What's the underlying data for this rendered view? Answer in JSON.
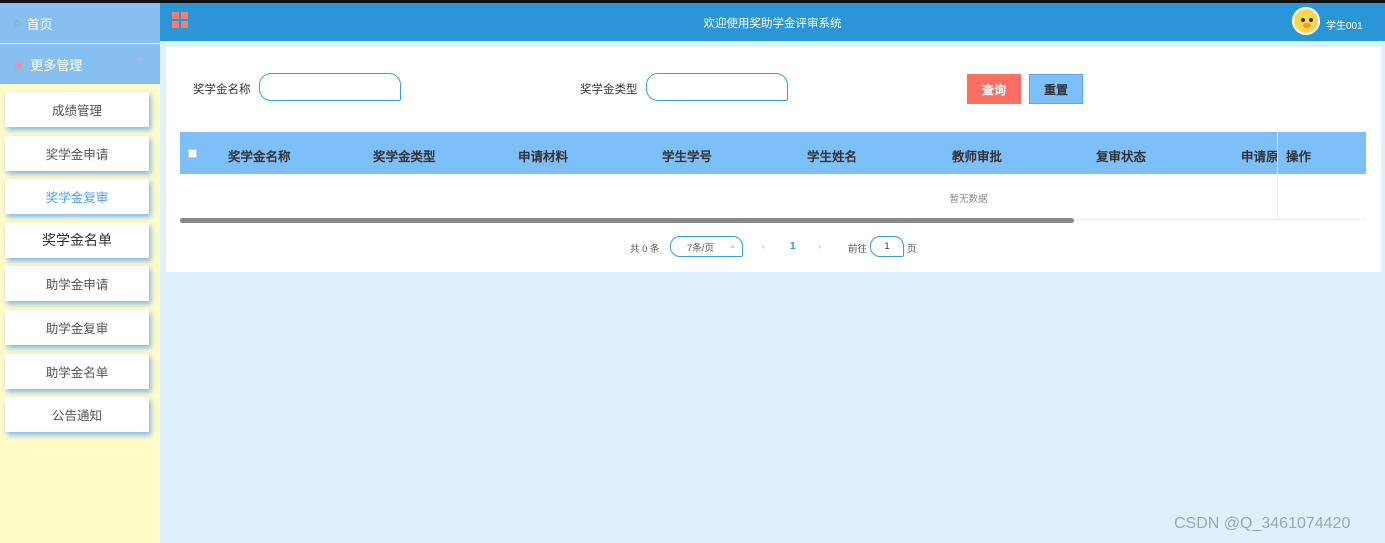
{
  "sidebar": {
    "home": "首页",
    "more": "更多管理",
    "items": [
      {
        "label": "成绩管理"
      },
      {
        "label": "奖学金申请"
      },
      {
        "label": "奖学金复审"
      },
      {
        "label": "奖学金名单"
      },
      {
        "label": "助学金申请"
      },
      {
        "label": "助学金复审"
      },
      {
        "label": "助学金名单"
      },
      {
        "label": "公告通知"
      }
    ]
  },
  "header": {
    "title": "欢迎使用奖助学金评审系统",
    "username": "学生001"
  },
  "search": {
    "name_label": "奖学金名称",
    "name_value": "",
    "type_label": "奖学金类型",
    "type_value": "",
    "search_btn": "查询",
    "reset_btn": "重置"
  },
  "table": {
    "columns": [
      "奖学金名称",
      "奖学金类型",
      "申请材料",
      "学生学号",
      "学生姓名",
      "教师审批",
      "复审状态",
      "申请原"
    ],
    "op_column": "操作",
    "empty_text": "暂无数据"
  },
  "pagination": {
    "total": "共 0 条",
    "page_size": "7条/页",
    "current_page": "1",
    "goto_label": "前往",
    "goto_value": "1",
    "page_suffix": "页"
  },
  "watermark": "CSDN @Q_3461074420",
  "colors": {
    "header_bg": "#2a96d8",
    "sidebar_bg": "#fffbc8",
    "table_head_bg": "#7cbff9",
    "search_btn": "#ff6f61",
    "reset_btn": "#7cc0fb",
    "content_bg": "#dff0fd"
  }
}
